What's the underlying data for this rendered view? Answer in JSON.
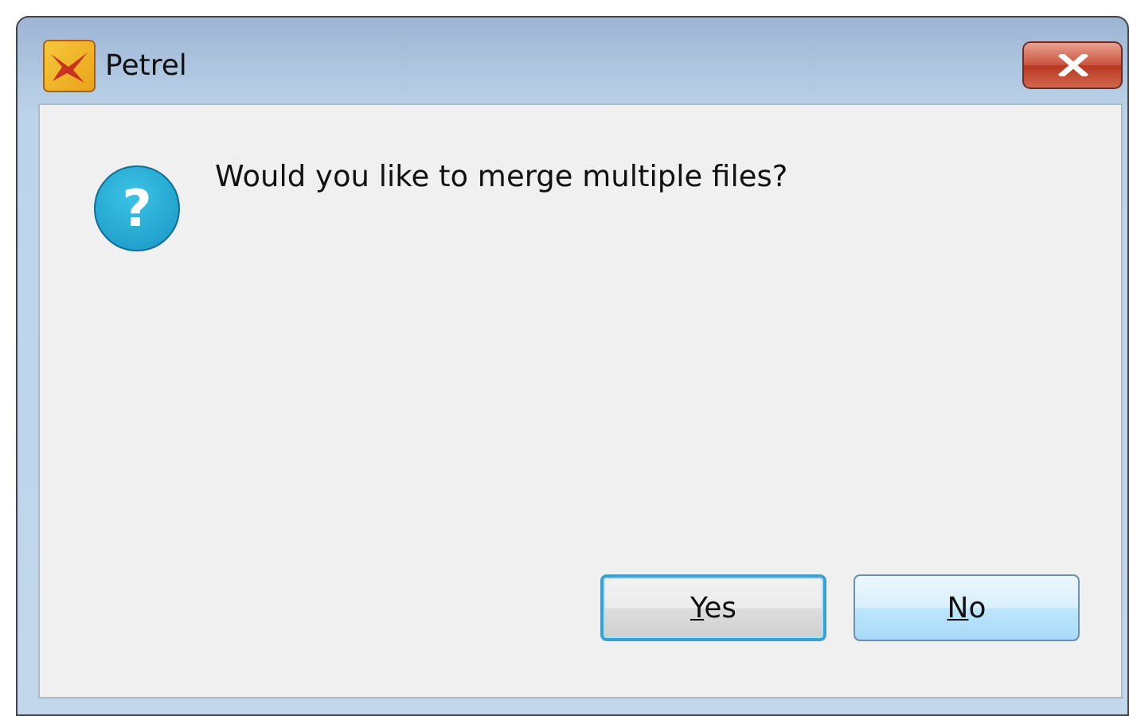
{
  "window": {
    "title": "Petrel"
  },
  "dialog": {
    "icon_glyph": "?",
    "message": "Would you like to merge multiple files?"
  },
  "buttons": [
    {
      "label": "Yes",
      "focused": true
    },
    {
      "label": "No",
      "focused": false
    }
  ]
}
